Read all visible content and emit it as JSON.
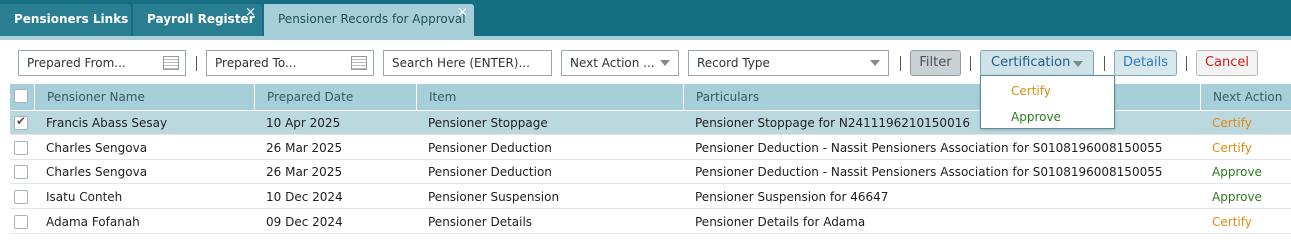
{
  "tabs": [
    {
      "label": "Pensioners Links",
      "closable": false
    },
    {
      "label": "Payroll Register",
      "closable": true
    },
    {
      "label": "Pensioner Records for Approval",
      "closable": true,
      "active": true
    }
  ],
  "close_glyph": "×",
  "toolbar": {
    "prepared_from_placeholder": "Prepared From...",
    "prepared_to_placeholder": "Prepared To...",
    "search_placeholder": "Search Here (ENTER)...",
    "next_action_placeholder": "Next Action ...",
    "record_type_placeholder": "Record Type",
    "filter_label": "Filter",
    "certification_label": "Certification",
    "details_label": "Details",
    "cancel_label": "Cancel"
  },
  "certification_menu": {
    "items": [
      "Certify",
      "Approve"
    ]
  },
  "table": {
    "columns": [
      "Pensioner Name",
      "Prepared Date",
      "Item",
      "Particulars",
      "Next Action"
    ],
    "rows": [
      {
        "selected": true,
        "name": "Francis Abass Sesay",
        "date": "10 Apr 2025",
        "item": "Pensioner Stoppage",
        "particulars": "Pensioner Stoppage for N2411196210150016",
        "action": "Certify"
      },
      {
        "selected": false,
        "name": "Charles Sengova",
        "date": "26 Mar 2025",
        "item": "Pensioner Deduction",
        "particulars": "Pensioner Deduction - Nassit Pensioners Association for S0108196008150055",
        "action": "Certify"
      },
      {
        "selected": false,
        "name": "Charles Sengova",
        "date": "26 Mar 2025",
        "item": "Pensioner Deduction",
        "particulars": "Pensioner Deduction - Nassit Pensioners Association for S0108196008150055",
        "action": "Approve"
      },
      {
        "selected": false,
        "name": "Isatu Conteh",
        "date": "10 Dec 2024",
        "item": "Pensioner Suspension",
        "particulars": "Pensioner Suspension for 46647",
        "action": "Approve"
      },
      {
        "selected": false,
        "name": "Adama Fofanah",
        "date": "09 Dec 2024",
        "item": "Pensioner Details",
        "particulars": "Pensioner Details for Adama",
        "action": "Certify"
      }
    ]
  },
  "colors": {
    "tabbar": "#156e82",
    "header": "#a7cfd9",
    "certify": "#e08a10",
    "approve": "#2d7a1f",
    "cancel": "#d21a1a"
  }
}
